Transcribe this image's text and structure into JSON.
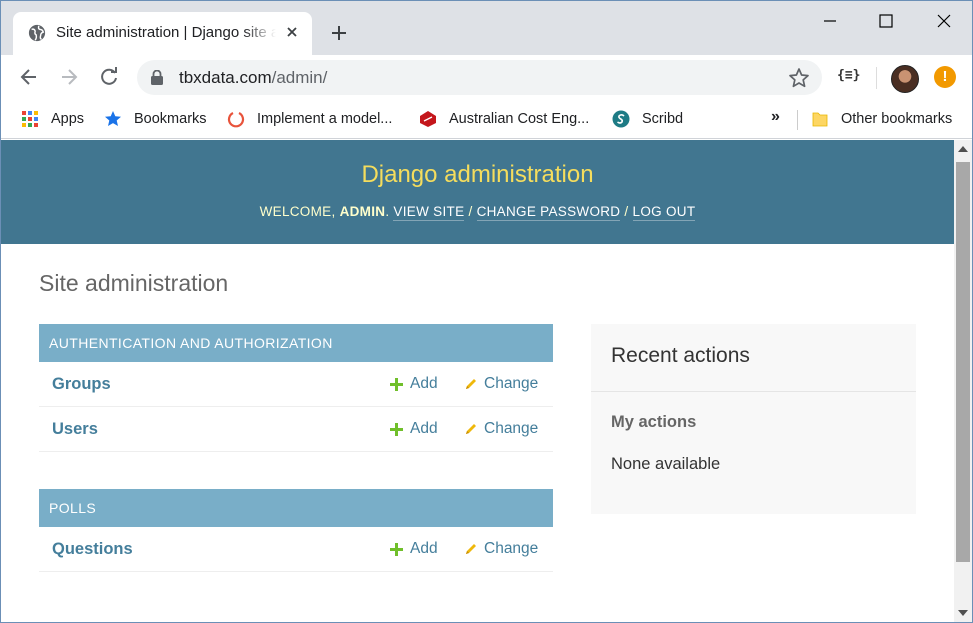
{
  "browser": {
    "tab_title": "Site administration | Django site admin",
    "url_host": "tbxdata.com",
    "url_path": "/admin/",
    "json_ext_label": "{≡}",
    "alert_badge": "!",
    "bookmarks": [
      {
        "label": "Apps",
        "icon": "apps-grid-icon"
      },
      {
        "label": "Bookmarks",
        "icon": "star-icon"
      },
      {
        "label": "Implement a model...",
        "icon": "ring-icon"
      },
      {
        "label": "Australian Cost Eng...",
        "icon": "red-cube-icon"
      },
      {
        "label": "Scribd",
        "icon": "scribd-icon"
      }
    ],
    "bookmarks_more": "»",
    "other_bookmarks": "Other bookmarks"
  },
  "header": {
    "branding": "Django administration",
    "welcome": "Welcome,",
    "username": "admin",
    "view_site": "View site",
    "change_password": "Change password",
    "log_out": "Log out",
    "sep": "/"
  },
  "page": {
    "title": "Site administration"
  },
  "modules": [
    {
      "caption": "Authentication and Authorization",
      "rows": [
        {
          "name": "Groups",
          "add": "Add",
          "change": "Change"
        },
        {
          "name": "Users",
          "add": "Add",
          "change": "Change"
        }
      ]
    },
    {
      "caption": "Polls",
      "rows": [
        {
          "name": "Questions",
          "add": "Add",
          "change": "Change"
        }
      ]
    }
  ],
  "recent": {
    "title": "Recent actions",
    "subtitle": "My actions",
    "empty": "None available"
  },
  "colors": {
    "header_bg": "#417690",
    "branding": "#f5dd5d",
    "caption_bg": "#79aec8",
    "link": "#447e9b",
    "add_icon": "#70bf2b",
    "change_icon": "#efb80b"
  }
}
